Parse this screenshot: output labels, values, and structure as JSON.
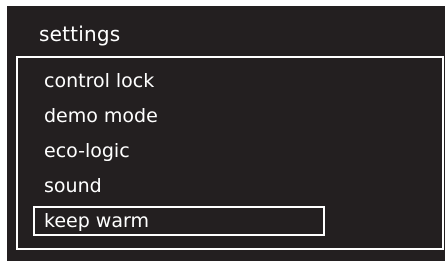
{
  "screen": {
    "title": "settings",
    "menu": {
      "items": [
        {
          "label": "control lock",
          "selected": false
        },
        {
          "label": "demo mode",
          "selected": false
        },
        {
          "label": "eco-logic",
          "selected": false
        },
        {
          "label": "sound",
          "selected": false
        },
        {
          "label": "keep warm",
          "selected": true
        }
      ]
    }
  },
  "colors": {
    "background": "#231f20",
    "foreground": "#ffffff",
    "page": "#ffffff"
  }
}
